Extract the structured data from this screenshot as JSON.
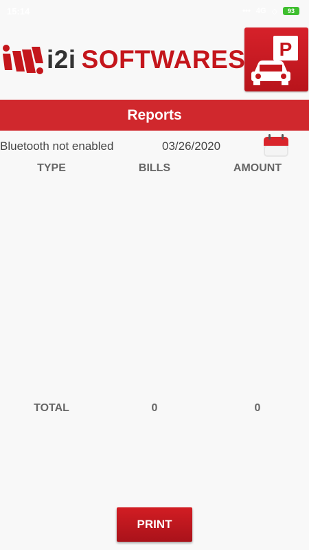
{
  "status_bar": {
    "time": "15:14",
    "network": "4G",
    "battery": "93",
    "icons": [
      "signal-icon",
      "wifi-icon",
      "battery-icon"
    ]
  },
  "header": {
    "brand_prefix": "i2i",
    "brand_name": "SOFTWARES",
    "app_icon": "parking-car-icon",
    "app_icon_letter": "P"
  },
  "page": {
    "title": "Reports"
  },
  "info": {
    "bluetooth_status": "Bluetooth not enabled",
    "date": "03/26/2020",
    "calendar_icon": "calendar-icon"
  },
  "table": {
    "columns": [
      "TYPE",
      "BILLS",
      "AMOUNT"
    ],
    "rows": []
  },
  "totals": {
    "label": "TOTAL",
    "bills": "0",
    "amount": "0"
  },
  "actions": {
    "print_label": "PRINT"
  },
  "colors": {
    "accent_red": "#d0282d",
    "text_gray": "#666666",
    "background": "#f8f8f8"
  }
}
